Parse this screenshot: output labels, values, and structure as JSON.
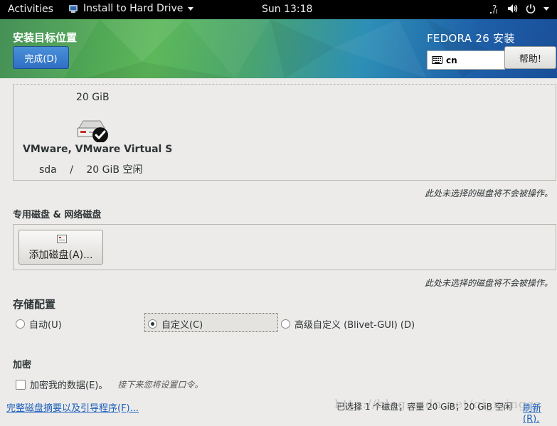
{
  "topbar": {
    "activities": "Activities",
    "app_name": "Install to Hard Drive",
    "clock": "Sun 13:18"
  },
  "header": {
    "title": "安装目标位置",
    "done_label": "完成(D)",
    "product": "FEDORA 26 安装",
    "keyboard_layout": "cn",
    "help_label": "帮助!"
  },
  "local_disk": {
    "size": "20 GiB",
    "name": "VMware, VMware Virtual S",
    "device": "sda",
    "separator": "/",
    "free": "20 GiB 空闲",
    "selected": true
  },
  "notes": {
    "unselected_local": "此处未选择的磁盘将不会被操作。",
    "unselected_special": "此处未选择的磁盘将不会被操作。"
  },
  "special": {
    "heading": "专用磁盘 & 网络磁盘",
    "add_disk_label": "添加磁盘(A)..."
  },
  "storage": {
    "heading": "存储配置",
    "options": [
      {
        "label": "自动(U)",
        "selected": false
      },
      {
        "label": "自定义(C)",
        "selected": true
      },
      {
        "label": "高级自定义 (Blivet-GUI) (D)",
        "selected": false
      }
    ]
  },
  "encryption": {
    "heading": "加密",
    "checkbox_label": "加密我的数据(E)。",
    "hint": "接下来您将设置口令。"
  },
  "footer": {
    "summary_link": "完整磁盘摘要以及引导程序(F)...",
    "summary": "已选择 1 个磁盘；容量 20 GiB；20 GiB 空闲",
    "refresh_link": "刷新(R)."
  },
  "watermark": "http://blog.csdn.net/qi_mingcs"
}
